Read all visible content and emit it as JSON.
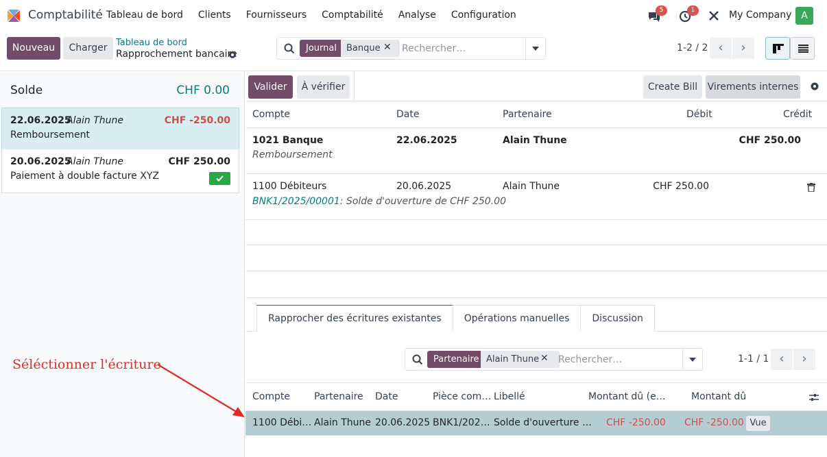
{
  "app": {
    "name": "Comptabilité",
    "company": "My Company",
    "avatar_letter": "A"
  },
  "menu": [
    "Tableau de bord",
    "Clients",
    "Fournisseurs",
    "Comptabilité",
    "Analyse",
    "Configuration"
  ],
  "systray": {
    "chat_count": "5",
    "activity_count": "1"
  },
  "control": {
    "new_label": "Nouveau",
    "load_label": "Charger",
    "breadcrumb_parent": "Tableau de bord",
    "breadcrumb_current": "Rapprochement bancaire",
    "search_facet_key": "Journal",
    "search_facet_value": "Banque",
    "search_placeholder": "Rechercher…",
    "pager": "1-2 / 2"
  },
  "left": {
    "solde_label": "Solde",
    "solde_value": "CHF 0.00",
    "lines": [
      {
        "date": "22.06.2025",
        "partner": "Alain Thune",
        "amount": "CHF -250.00",
        "label": "Remboursement"
      },
      {
        "date": "20.06.2025",
        "partner": "Alain Thune",
        "amount": "CHF 250.00",
        "label": "Paiement à double facture XYZ"
      }
    ]
  },
  "right": {
    "validate_label": "Valider",
    "to_check_label": "À vérifier",
    "create_bill_label": "Create Bill",
    "internal_transfers_label": "Virements internes",
    "columns": [
      "Compte",
      "Date",
      "Partenaire",
      "Débit",
      "Crédit"
    ],
    "rows": [
      {
        "account": "1021 Banque",
        "date": "22.06.2025",
        "partner": "Alain Thune",
        "debit": "",
        "credit": "CHF 250.00",
        "sub_link": "",
        "sub_text": "Remboursement"
      },
      {
        "account": "1100 Débiteurs",
        "date": "20.06.2025",
        "partner": "Alain Thune",
        "debit": "CHF 250.00",
        "credit": "",
        "sub_link": "BNK1/2025/00001",
        "sub_text": ": Solde d'ouverture de CHF 250.00"
      }
    ],
    "tabs": [
      "Rapprocher des écritures existantes",
      "Opérations manuelles",
      "Discussion"
    ],
    "sub_search": {
      "facet_key": "Partenaire",
      "facet_value": "Alain Thune",
      "placeholder": "Rechercher…",
      "pager": "1-1 / 1"
    },
    "sub_columns": [
      "Compte",
      "Partenaire",
      "Date",
      "Pièce com…",
      "Libellé",
      "Montant dû (e…",
      "Montant dû"
    ],
    "sub_row": {
      "account": "1100 Débi…",
      "partner": "Alain Thune",
      "date": "20.06.2025",
      "move": "BNK1/202…",
      "label": "Solde d'ouverture …",
      "amount_currency": "CHF -250.00",
      "amount": "CHF -250.00",
      "view_label": "Vue"
    }
  },
  "annotation": "Séléctionner l'écriture",
  "colors": {
    "primary": "#714B67",
    "teal": "#017e84",
    "negative": "#d44c4c",
    "selected_row": "#b4cdd3",
    "annotation": "#e22a23"
  }
}
